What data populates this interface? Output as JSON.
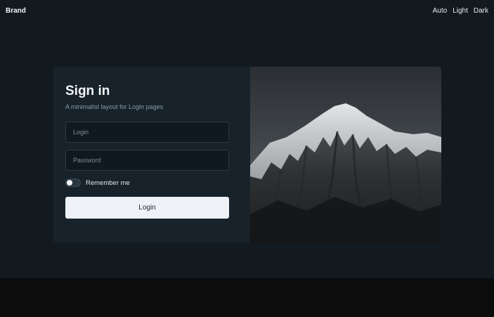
{
  "navbar": {
    "brand": "Brand",
    "theme_options": [
      "Auto",
      "Light",
      "Dark"
    ]
  },
  "login": {
    "title": "Sign in",
    "subtitle": "A minimalist layout for Login pages",
    "login_placeholder": "Login",
    "password_placeholder": "Password",
    "remember_label": "Remember me",
    "remember_checked": false,
    "submit_label": "Login"
  },
  "image": {
    "icon": "mountain-photo"
  },
  "colors": {
    "background": "#121a20",
    "card": "#17222a",
    "button": "#eef2f6",
    "footer": "#0c0c0c"
  }
}
